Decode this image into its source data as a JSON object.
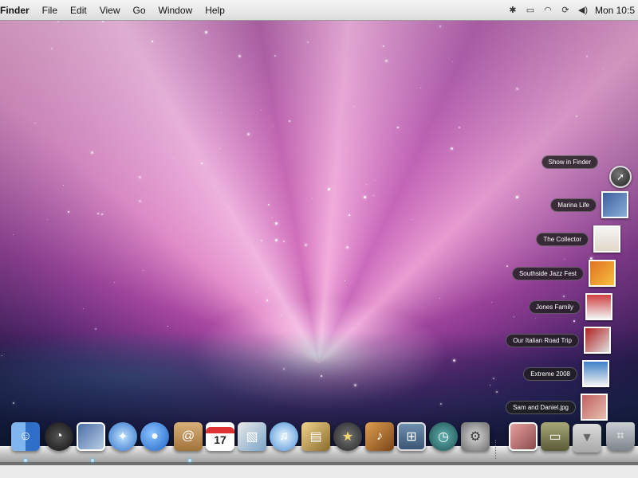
{
  "menubar": {
    "app_name": "Finder",
    "menus": [
      "File",
      "Edit",
      "View",
      "Go",
      "Window",
      "Help"
    ],
    "status_icons": [
      "bluetooth-icon",
      "display-icon",
      "wifi-icon",
      "sync-icon",
      "volume-icon"
    ],
    "clock": "Mon 10:5"
  },
  "stack": {
    "action_label": "Show in Finder",
    "items": [
      {
        "label": "Marina Life"
      },
      {
        "label": "The Collector"
      },
      {
        "label": "Southside Jazz Fest"
      },
      {
        "label": "Jones Family"
      },
      {
        "label": "Our Italian Road Trip"
      },
      {
        "label": "Extreme 2008"
      },
      {
        "label": "Sam and Daniel.jpg"
      }
    ]
  },
  "calendar": {
    "day": "17"
  },
  "dock": {
    "apps": [
      {
        "name": "finder-icon",
        "color": "#3f7fd6"
      },
      {
        "name": "dashboard-icon",
        "color": "#3a3a3a"
      },
      {
        "name": "preview-icon",
        "color": "#6f8fb8"
      },
      {
        "name": "safari-icon",
        "color": "#4d8fd8"
      },
      {
        "name": "ichat-icon",
        "color": "#3d89d6"
      },
      {
        "name": "address-book-icon",
        "color": "#c89a5b"
      },
      {
        "name": "ical-icon",
        "color": "#ffffff"
      },
      {
        "name": "iphoto-icon",
        "color": "#7aa4c8"
      },
      {
        "name": "itunes-icon",
        "color": "#5aa0e0"
      },
      {
        "name": "front-row-icon",
        "color": "#c0a060"
      },
      {
        "name": "imovie-icon",
        "color": "#444444"
      },
      {
        "name": "garageband-icon",
        "color": "#b07030"
      },
      {
        "name": "spaces-icon",
        "color": "#557799"
      },
      {
        "name": "time-machine-icon",
        "color": "#2f6a6a"
      },
      {
        "name": "system-preferences-icon",
        "color": "#999999"
      },
      {
        "name": "photos-stack-icon",
        "color": "#c47a7a"
      },
      {
        "name": "documents-stack-icon",
        "color": "#8a8a5a"
      },
      {
        "name": "downloads-stack-icon",
        "color": "#bfbfbf"
      },
      {
        "name": "trash-icon",
        "color": "#9aa0a6"
      }
    ]
  }
}
